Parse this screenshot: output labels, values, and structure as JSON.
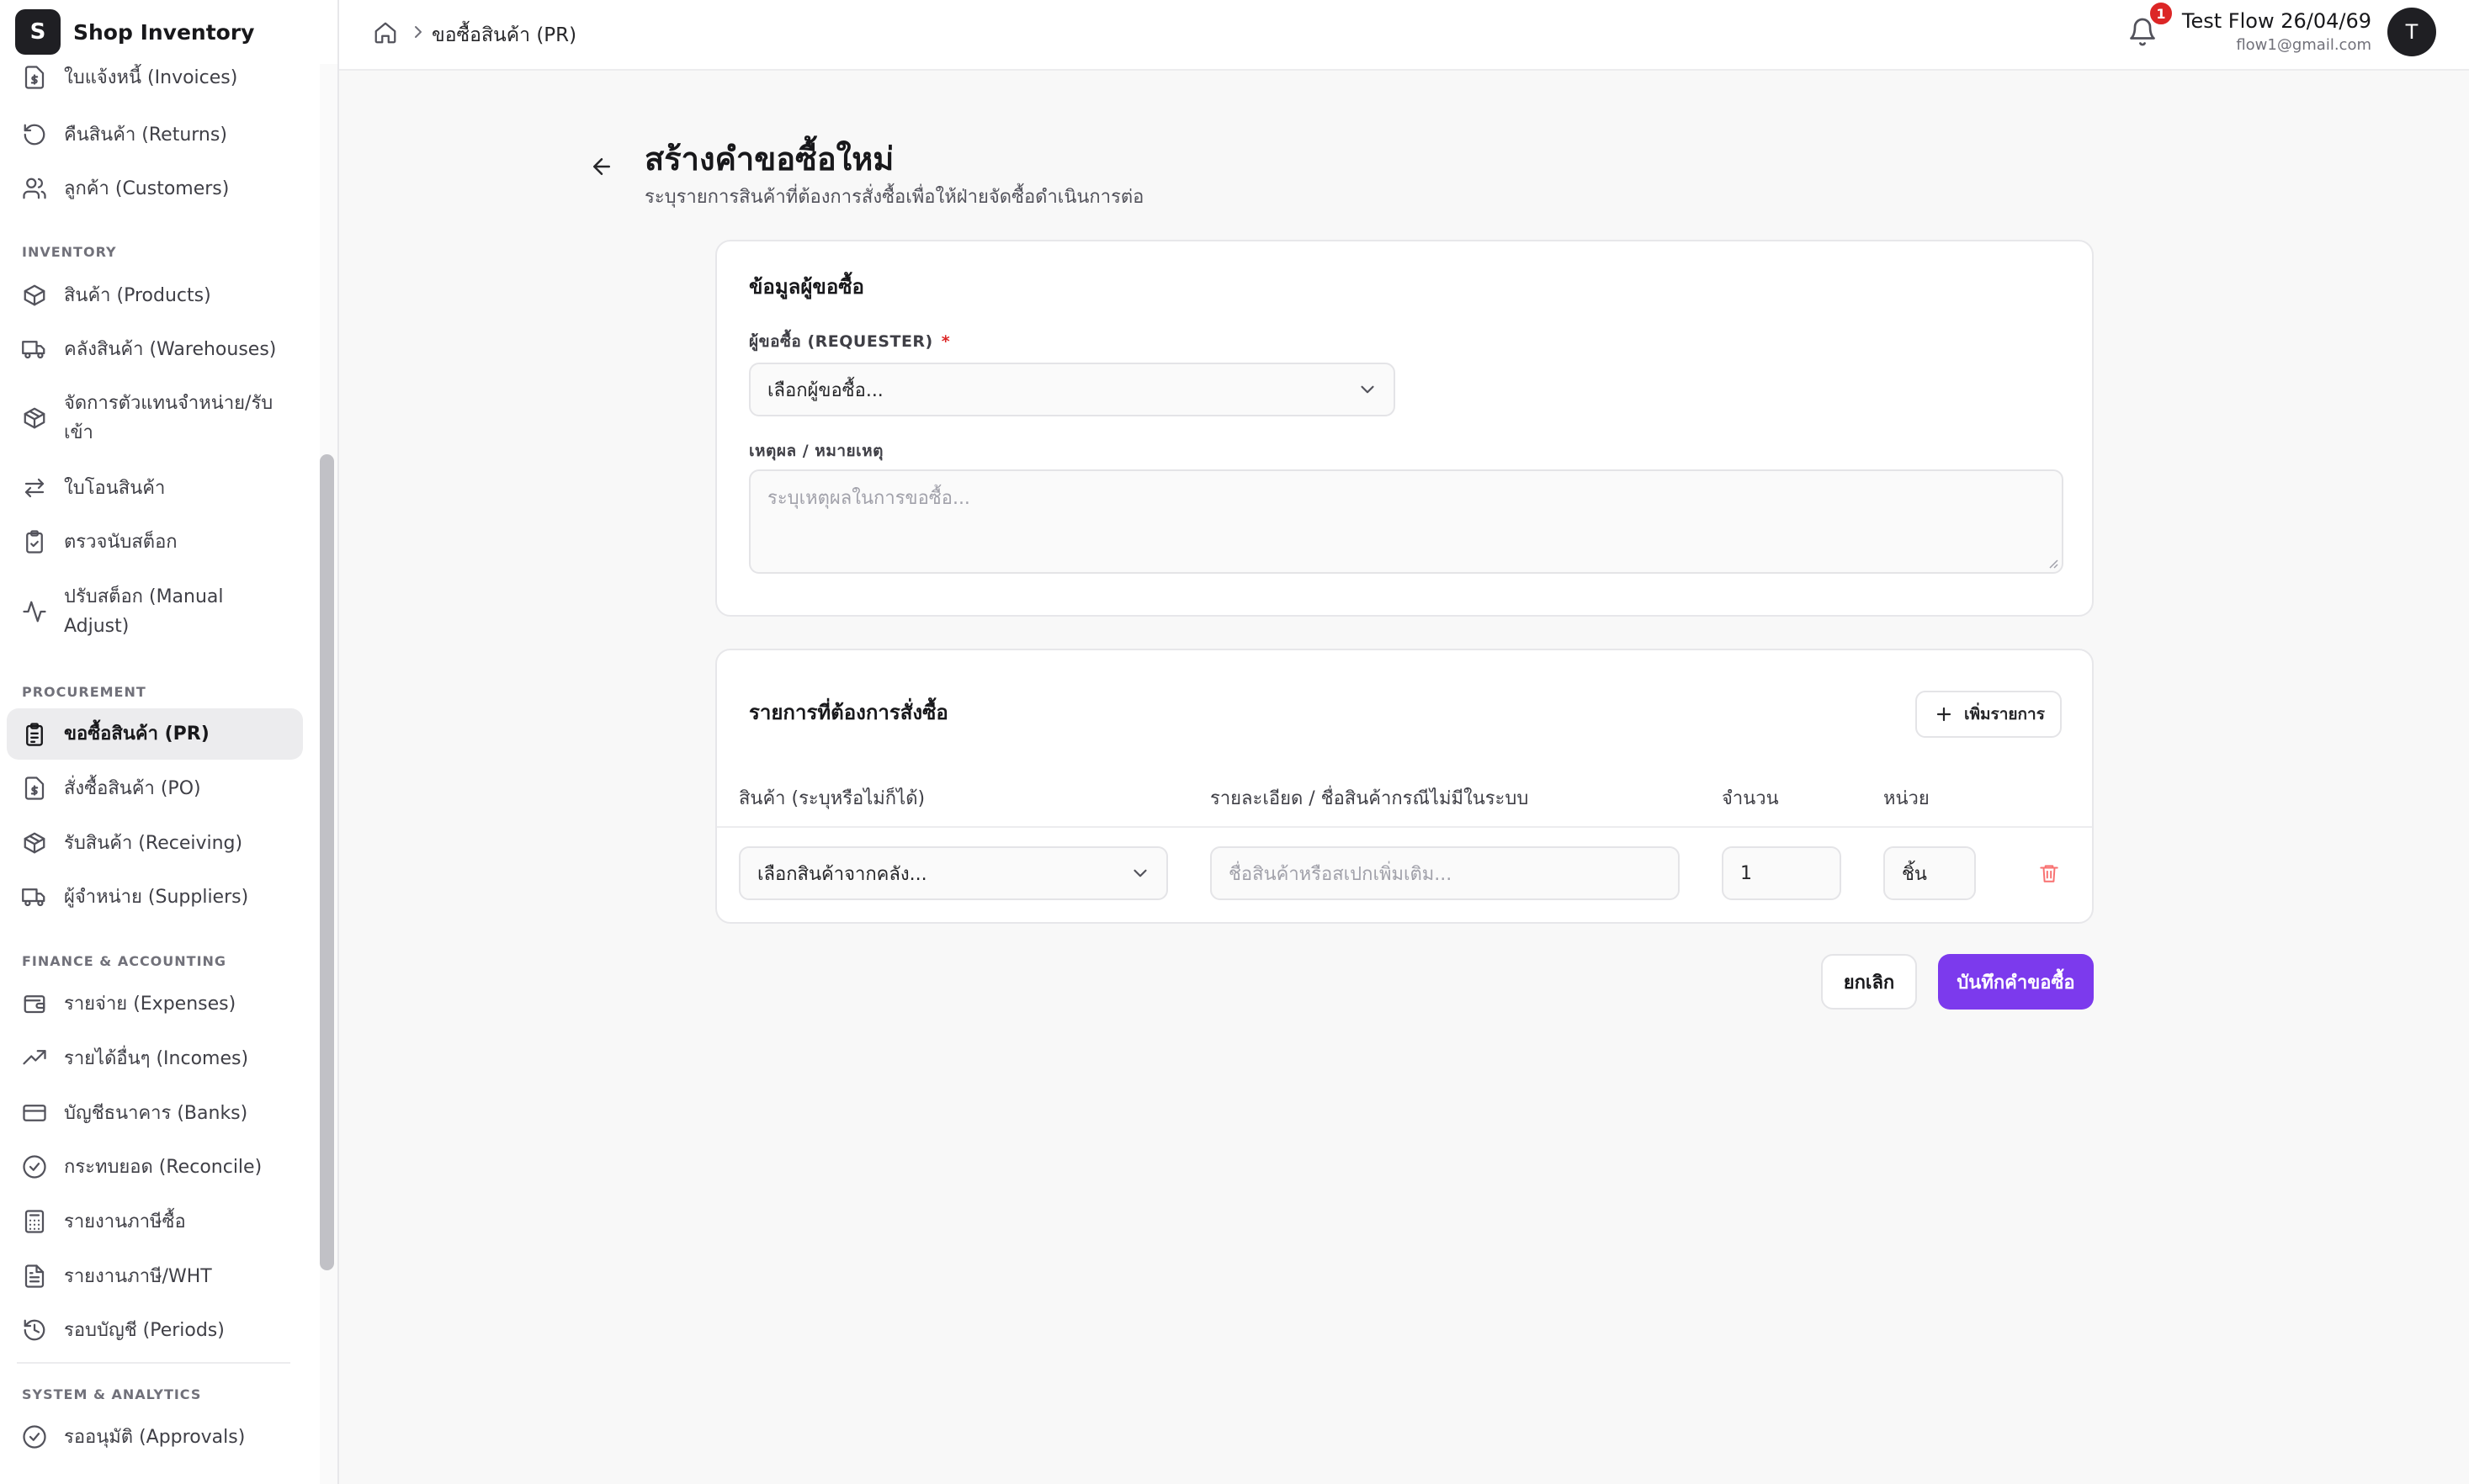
{
  "app": {
    "logo_letter": "S",
    "name": "Shop Inventory"
  },
  "sidebar": {
    "items_top": [
      {
        "label": "ใบแจ้งหนี้ (Invoices)",
        "icon": "dollar-doc-icon"
      },
      {
        "label": "คืนสินค้า (Returns)",
        "icon": "undo-icon"
      },
      {
        "label": "ลูกค้า (Customers)",
        "icon": "users-icon"
      }
    ],
    "sections": [
      {
        "title": "INVENTORY",
        "items": [
          {
            "label": "สินค้า (Products)",
            "icon": "box-icon"
          },
          {
            "label": "คลังสินค้า (Warehouses)",
            "icon": "truck-icon"
          },
          {
            "label": "จัดการตัวแทนจำหน่าย/รับเข้า",
            "icon": "package-icon"
          },
          {
            "label": "ใบโอนสินค้า",
            "icon": "transfer-icon"
          },
          {
            "label": "ตรวจนับสต็อก",
            "icon": "clipboard-check-icon"
          },
          {
            "label": "ปรับสต็อก (Manual Adjust)",
            "icon": "activity-icon"
          }
        ]
      },
      {
        "title": "PROCUREMENT",
        "items": [
          {
            "label": "ขอซื้อสินค้า (PR)",
            "icon": "clipboard-list-icon",
            "active": true
          },
          {
            "label": "สั่งซื้อสินค้า (PO)",
            "icon": "dollar-doc-icon"
          },
          {
            "label": "รับสินค้า (Receiving)",
            "icon": "package-icon"
          },
          {
            "label": "ผู้จำหน่าย (Suppliers)",
            "icon": "truck-icon"
          }
        ]
      },
      {
        "title": "FINANCE & ACCOUNTING",
        "items": [
          {
            "label": "รายจ่าย (Expenses)",
            "icon": "wallet-icon"
          },
          {
            "label": "รายได้อื่นๆ (Incomes)",
            "icon": "trending-up-icon"
          },
          {
            "label": "บัญชีธนาคาร (Banks)",
            "icon": "credit-card-icon"
          },
          {
            "label": "กระทบยอด (Reconcile)",
            "icon": "check-circle-icon"
          },
          {
            "label": "รายงานภาษีซื้อ",
            "icon": "calculator-icon"
          },
          {
            "label": "รายงานภาษี/WHT",
            "icon": "file-text-icon"
          },
          {
            "label": "รอบบัญชี (Periods)",
            "icon": "history-icon"
          }
        ]
      },
      {
        "title": "SYSTEM & ANALYTICS",
        "items": [
          {
            "label": "รออนุมัติ (Approvals)",
            "icon": "check-circle-icon"
          }
        ]
      }
    ]
  },
  "header": {
    "breadcrumb_current": "ขอซื้อสินค้า (PR)",
    "notification_count": "1",
    "user_name": "Test Flow 26/04/69",
    "user_email": "flow1@gmail.com",
    "avatar_letter": "T"
  },
  "page": {
    "title": "สร้างคำขอซื้อใหม่",
    "subtitle": "ระบุรายการสินค้าที่ต้องการสั่งซื้อเพื่อให้ฝ่ายจัดซื้อดำเนินการต่อ"
  },
  "requester_card": {
    "title": "ข้อมูลผู้ขอซื้อ",
    "requester_label": "ผู้ขอซื้อ (REQUESTER)",
    "required_mark": "*",
    "requester_value": "เลือกผู้ขอซื้อ...",
    "reason_label": "เหตุผล / หมายเหตุ",
    "reason_placeholder": "ระบุเหตุผลในการขอซื้อ..."
  },
  "items_card": {
    "title": "รายการที่ต้องการสั่งซื้อ",
    "add_button": "เพิ่มรายการ",
    "columns": {
      "product": "สินค้า (ระบุหรือไม่ก็ได้)",
      "detail": "รายละเอียด / ชื่อสินค้ากรณีไม่มีในระบบ",
      "qty": "จำนวน",
      "unit": "หน่วย"
    },
    "rows": [
      {
        "product": "เลือกสินค้าจากคลัง...",
        "detail_placeholder": "ชื่อสินค้าหรือสเปกเพิ่มเติม...",
        "qty": "1",
        "unit": "ชิ้น"
      }
    ]
  },
  "actions": {
    "cancel": "ยกเลิก",
    "save": "บันทึกคำขอซื้อ"
  },
  "colors": {
    "primary": "#7c3aed",
    "danger": "#dc2626",
    "sidebar_active": "#ececee"
  }
}
